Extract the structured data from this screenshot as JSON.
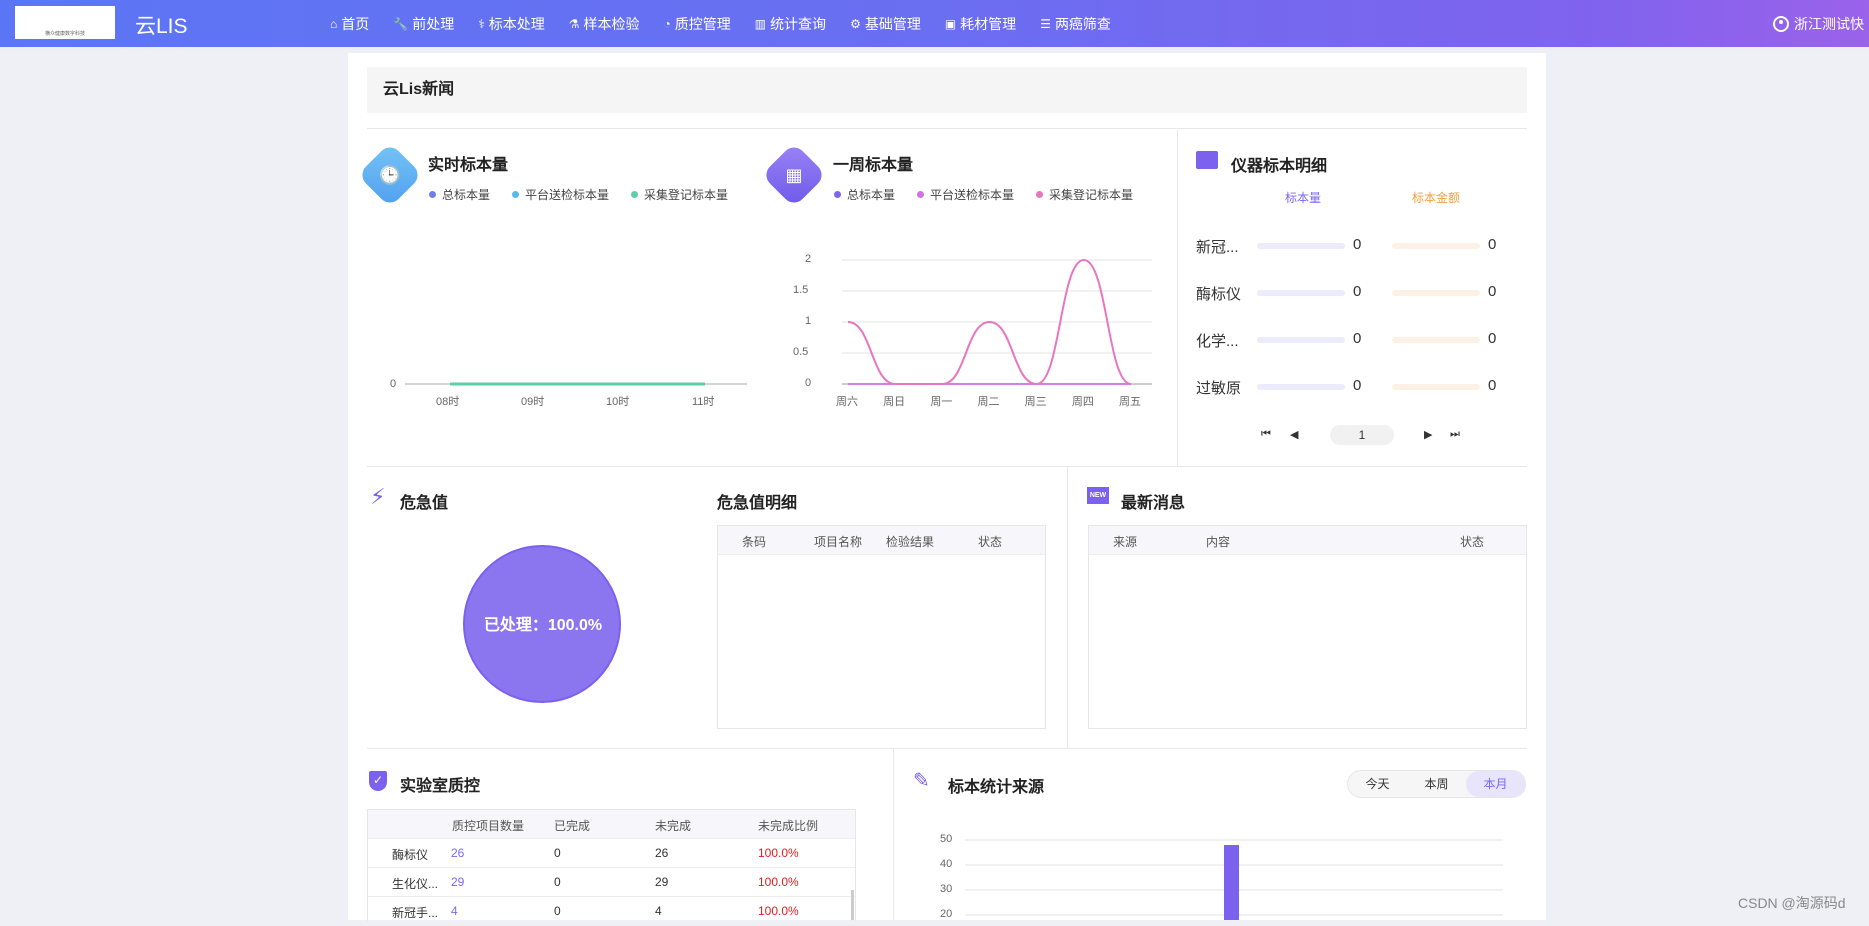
{
  "header": {
    "logo_text": "横众健康数字科技",
    "app_title": "云LIS",
    "nav": [
      {
        "label": "首页",
        "icon": "home-icon",
        "glyph": "⌂"
      },
      {
        "label": "前处理",
        "icon": "wrench-icon",
        "glyph": "🔧"
      },
      {
        "label": "标本处理",
        "icon": "stethoscope-icon",
        "glyph": "⚕"
      },
      {
        "label": "样本检验",
        "icon": "flask-icon",
        "glyph": "⚗"
      },
      {
        "label": "质控管理",
        "icon": "pie-chart-icon",
        "glyph": "◔"
      },
      {
        "label": "统计查询",
        "icon": "bar-chart-icon",
        "glyph": "▥"
      },
      {
        "label": "基础管理",
        "icon": "gear-icon",
        "glyph": "⚙"
      },
      {
        "label": "耗材管理",
        "icon": "briefcase-icon",
        "glyph": "▣"
      },
      {
        "label": "两癌筛查",
        "icon": "list-icon",
        "glyph": "☰"
      }
    ],
    "user": "浙江测试快"
  },
  "news": {
    "title": "云Lis新闻"
  },
  "realtime": {
    "title": "实时标本量",
    "legend": [
      "总标本量",
      "平台送检标本量",
      "采集登记标本量"
    ],
    "colors": [
      "#6f7ff0",
      "#5bb8ef",
      "#5ccfa8"
    ],
    "x_labels": [
      "08时",
      "09时",
      "10时",
      "11时"
    ],
    "y_labels": [
      "0"
    ]
  },
  "weekly": {
    "title": "一周标本量",
    "legend": [
      "总标本量",
      "平台送检标本量",
      "采集登记标本量"
    ],
    "colors": [
      "#7d66ef",
      "#d46fe4",
      "#e875c1"
    ],
    "x_labels": [
      "周六",
      "周日",
      "周一",
      "周二",
      "周三",
      "周四",
      "周五"
    ],
    "y_labels": [
      "0",
      "0.5",
      "1",
      "1.5",
      "2"
    ]
  },
  "chart_data": [
    {
      "type": "line",
      "title": "实时标本量",
      "x": [
        "08时",
        "09时",
        "10时",
        "11时"
      ],
      "series": [
        {
          "name": "总标本量",
          "values": [
            0,
            0,
            0,
            0
          ]
        },
        {
          "name": "平台送检标本量",
          "values": [
            0,
            0,
            0,
            0
          ]
        },
        {
          "name": "采集登记标本量",
          "values": [
            0,
            0,
            0,
            0
          ]
        }
      ]
    },
    {
      "type": "line",
      "title": "一周标本量",
      "x": [
        "周六",
        "周日",
        "周一",
        "周二",
        "周三",
        "周四",
        "周五"
      ],
      "ylim": [
        0,
        2
      ],
      "series": [
        {
          "name": "总标本量",
          "values": [
            0,
            0,
            0,
            0,
            0,
            0,
            0
          ]
        },
        {
          "name": "平台送检标本量",
          "values": [
            0,
            0,
            0,
            0,
            0,
            0,
            0
          ]
        },
        {
          "name": "采集登记标本量",
          "values": [
            1,
            0,
            0,
            1,
            0,
            2,
            0
          ]
        }
      ]
    },
    {
      "type": "pie",
      "title": "危急值",
      "categories": [
        "已处理"
      ],
      "values": [
        100.0
      ]
    },
    {
      "type": "bar",
      "title": "标本统计来源",
      "y_labels": [
        "50",
        "40",
        "30",
        "20"
      ],
      "ylim": [
        0,
        50
      ],
      "values": [
        48
      ]
    }
  ],
  "instrument": {
    "title": "仪器标本明细",
    "col_count": "标本量",
    "col_amount": "标本金额",
    "rows": [
      {
        "name": "新冠...",
        "count": "0",
        "amount": "0"
      },
      {
        "name": "酶标仪",
        "count": "0",
        "amount": "0"
      },
      {
        "name": "化学...",
        "count": "0",
        "amount": "0"
      },
      {
        "name": "过敏原",
        "count": "0",
        "amount": "0"
      }
    ],
    "page": "1"
  },
  "critical": {
    "title": "危急值",
    "pie_label": "已处理：100.0%",
    "color": "#8b76f0"
  },
  "critical_detail": {
    "title": "危急值明细",
    "columns": [
      "条码",
      "项目名称",
      "检验结果",
      "状态"
    ]
  },
  "latest": {
    "title": "最新消息",
    "columns": [
      "来源",
      "内容",
      "状态"
    ]
  },
  "qc": {
    "title": "实验室质控",
    "columns": [
      "质控项目数量",
      "已完成",
      "未完成",
      "未完成比例"
    ],
    "rows": [
      {
        "name": "酶标仪",
        "count": "26",
        "done": "0",
        "undone": "26",
        "ratio": "100.0%"
      },
      {
        "name": "生化仪...",
        "count": "29",
        "done": "0",
        "undone": "29",
        "ratio": "100.0%"
      },
      {
        "name": "新冠手...",
        "count": "4",
        "done": "0",
        "undone": "4",
        "ratio": "100.0%"
      }
    ]
  },
  "source": {
    "title": "标本统计来源",
    "tabs": [
      "今天",
      "本周",
      "本月"
    ],
    "active_tab": "本月",
    "y_labels": [
      "50",
      "40",
      "30",
      "20"
    ]
  },
  "watermark": "CSDN @淘源码d"
}
